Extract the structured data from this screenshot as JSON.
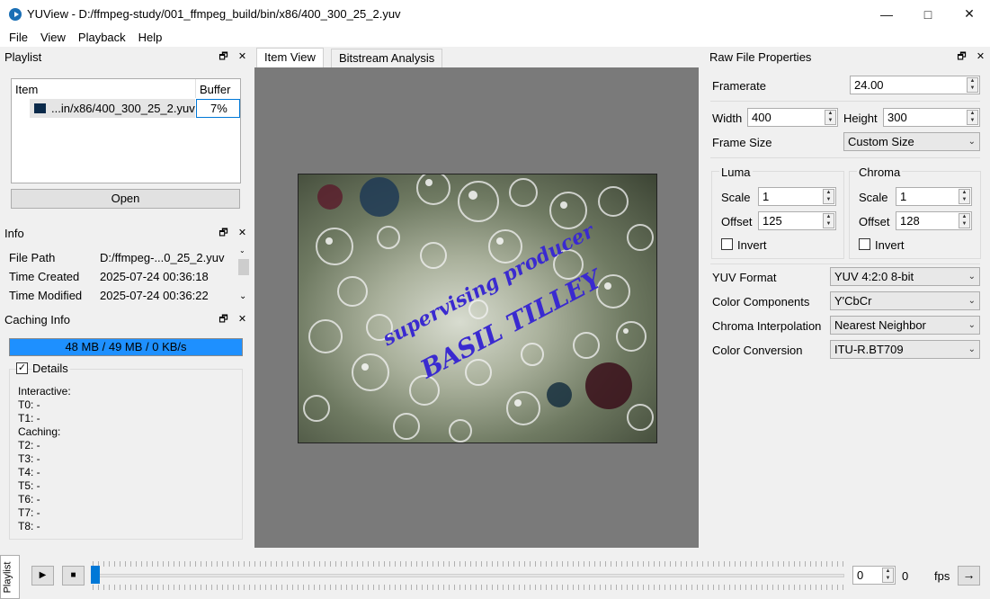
{
  "window": {
    "title": "YUView - D:/ffmpeg-study/001_ffmpeg_build/bin/x86/400_300_25_2.yuv",
    "min_icon": "—",
    "max_icon": "□",
    "close_icon": "✕"
  },
  "menu": [
    "File",
    "View",
    "Playback",
    "Help"
  ],
  "dock_icons": {
    "float": "🗗",
    "close": "✕"
  },
  "playlist": {
    "title": "Playlist",
    "col_item": "Item",
    "col_buffer": "Buffer",
    "row_name": "...in/x86/400_300_25_2.yuv",
    "row_buffer": "7%",
    "open_label": "Open"
  },
  "info": {
    "title": "Info",
    "rows": [
      {
        "k": "File Path",
        "v": "D:/ffmpeg-...0_25_2.yuv"
      },
      {
        "k": "Time Created",
        "v": "2025-07-24 00:36:18"
      },
      {
        "k": "Time Modified",
        "v": "2025-07-24 00:36:22"
      }
    ]
  },
  "caching": {
    "title": "Caching Info",
    "bar_text": "48 MB / 49 MB / 0 KB/s",
    "details_label": "Details",
    "details_checked": "✓",
    "lines": [
      "Interactive:",
      "T0: -",
      "T1: -",
      "Caching:",
      "T2: -",
      "T3: -",
      "T4: -",
      "T5: -",
      "T6: -",
      "T7: -",
      "T8: -"
    ]
  },
  "tabs": {
    "item_view": "Item View",
    "bitstream": "Bitstream Analysis"
  },
  "video_overlay": {
    "line1": "supervising producer",
    "line2": "BASIL TILLEY"
  },
  "raw": {
    "title": "Raw File Properties",
    "framerate_label": "Framerate",
    "framerate": "24.00",
    "width_label": "Width",
    "width": "400",
    "height_label": "Height",
    "height": "300",
    "framesize_label": "Frame Size",
    "framesize": "Custom Size",
    "luma": {
      "title": "Luma",
      "scale_label": "Scale",
      "scale": "1",
      "offset_label": "Offset",
      "offset": "125",
      "invert_label": "Invert"
    },
    "chroma": {
      "title": "Chroma",
      "scale_label": "Scale",
      "scale": "1",
      "offset_label": "Offset",
      "offset": "128",
      "invert_label": "Invert"
    },
    "yuv_format_label": "YUV Format",
    "yuv_format": "YUV 4:2:0 8-bit",
    "color_comp_label": "Color Components",
    "color_comp": "Y'CbCr",
    "chroma_interp_label": "Chroma Interpolation",
    "chroma_interp": "Nearest Neighbor",
    "color_conv_label": "Color Conversion",
    "color_conv": "ITU-R.BT709"
  },
  "playback": {
    "side_tab": "Playlist",
    "frame": "0",
    "total": "0",
    "fps_label": "fps",
    "play_icon": "▶",
    "stop_icon": "■",
    "next_icon": "→",
    "up_icon": "▲",
    "down_icon": "▼",
    "combo_icon": "⌄"
  },
  "colors": {
    "accent": "#0078d7",
    "view_bg": "#7a7a7a",
    "cache_bar": "#1e90ff"
  }
}
